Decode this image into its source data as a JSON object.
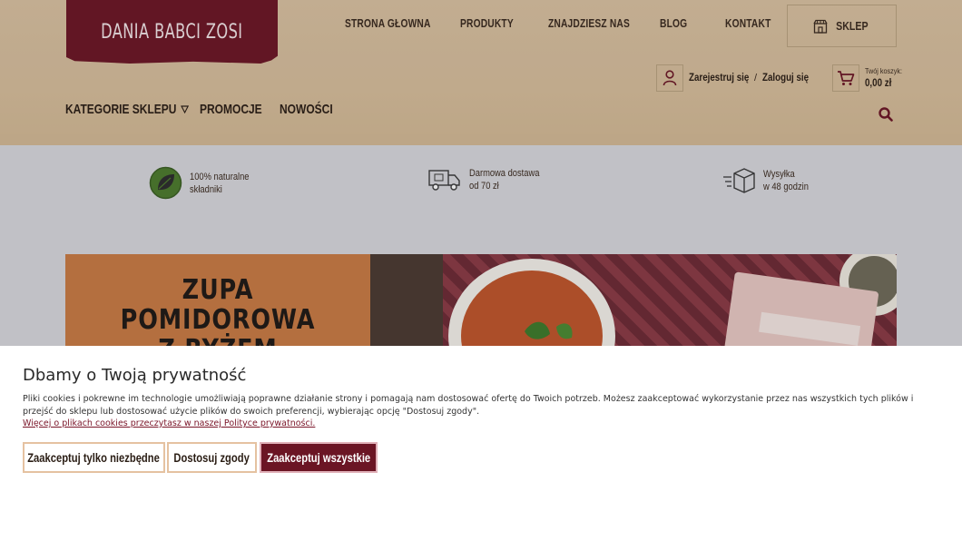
{
  "brand": {
    "logo_text": "DANIA BABCI ZOSI"
  },
  "topnav": [
    "STRONA GŁOWNA",
    "PRODUKTY",
    "ZNAJDZIESZ NAS",
    "BLOG",
    "KONTAKT"
  ],
  "shop_button": {
    "label": "SKLEP",
    "icon": "shop-icon"
  },
  "account": {
    "register": "Zarejestruj się",
    "separator": "/",
    "login": "Zaloguj się",
    "icon": "user-icon"
  },
  "cart": {
    "label": "Twój koszyk:",
    "amount": "0,00 zł",
    "icon": "cart-icon"
  },
  "subnav": {
    "categories": "KATEGORIE SKLEPU",
    "promotions": "PROMOCJE",
    "new": "NOWOŚCI"
  },
  "features": [
    {
      "line1": "100% naturalne",
      "line2": "składniki",
      "icon": "leaf-icon"
    },
    {
      "line1": "Darmowa dostawa",
      "line2": "od 70 zł",
      "icon": "truck-icon"
    },
    {
      "line1": "Wysyłka",
      "line2": "w 48 godzin",
      "icon": "box-icon"
    }
  ],
  "banner": {
    "line1": "ZUPA",
    "line2": "POMIDOROWA",
    "line3": "Z RYŻEM"
  },
  "cookie": {
    "title": "Dbamy o Twoją prywatność",
    "text": "Pliki cookies i pokrewne im technologie umożliwiają poprawne działanie strony i pomagają nam dostosować ofertę do Twoich potrzeb. Możesz zaakceptować wykorzystanie przez nas wszystkich tych plików i przejść do sklepu lub dostosować użycie plików do swoich preferencji, wybierając opcję \"Dostosuj zgody\".",
    "policy_link": "Więcej o plikach cookies przeczytasz w naszej Polityce prywatności.",
    "btn_necessary": "Zaakceptuj tylko niezbędne",
    "btn_customize": "Dostosuj zgody",
    "btn_accept_all": "Zaakceptuj wszystkie"
  },
  "colors": {
    "brand": "#6b1524",
    "header_bg": "#d9c1a0",
    "leaf_green": "#4c7a2c"
  }
}
